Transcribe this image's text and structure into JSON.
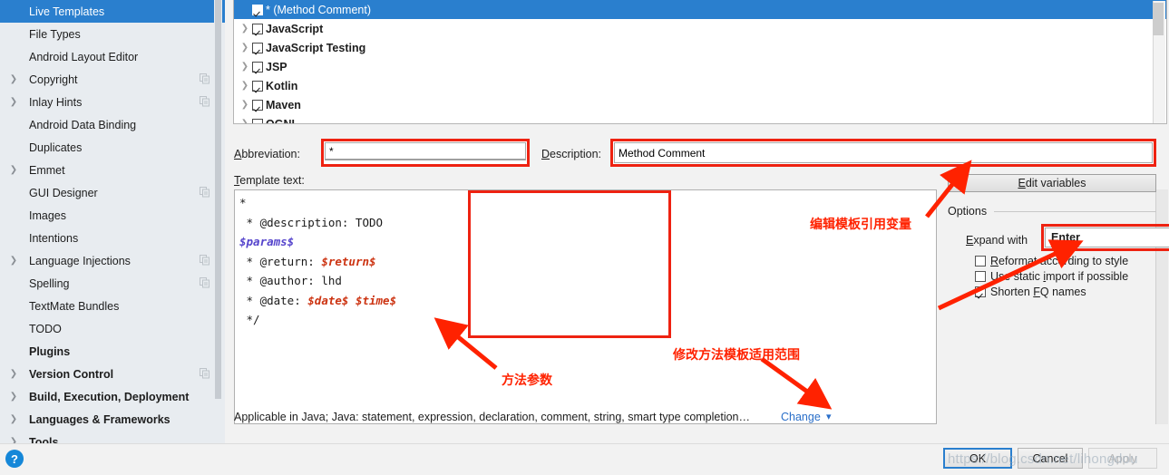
{
  "sidebar": {
    "items": [
      {
        "label": "Live Templates",
        "selected": true,
        "expandable": false,
        "bold": false,
        "copy": false
      },
      {
        "label": "File Types",
        "selected": false,
        "expandable": false,
        "bold": false,
        "copy": false
      },
      {
        "label": "Android Layout Editor",
        "selected": false,
        "expandable": false,
        "bold": false,
        "copy": false
      },
      {
        "label": "Copyright",
        "selected": false,
        "expandable": true,
        "bold": false,
        "copy": true
      },
      {
        "label": "Inlay Hints",
        "selected": false,
        "expandable": true,
        "bold": false,
        "copy": true
      },
      {
        "label": "Android Data Binding",
        "selected": false,
        "expandable": false,
        "bold": false,
        "copy": false
      },
      {
        "label": "Duplicates",
        "selected": false,
        "expandable": false,
        "bold": false,
        "copy": false
      },
      {
        "label": "Emmet",
        "selected": false,
        "expandable": true,
        "bold": false,
        "copy": false
      },
      {
        "label": "GUI Designer",
        "selected": false,
        "expandable": false,
        "bold": false,
        "copy": true
      },
      {
        "label": "Images",
        "selected": false,
        "expandable": false,
        "bold": false,
        "copy": false
      },
      {
        "label": "Intentions",
        "selected": false,
        "expandable": false,
        "bold": false,
        "copy": false
      },
      {
        "label": "Language Injections",
        "selected": false,
        "expandable": true,
        "bold": false,
        "copy": true
      },
      {
        "label": "Spelling",
        "selected": false,
        "expandable": false,
        "bold": false,
        "copy": true
      },
      {
        "label": "TextMate Bundles",
        "selected": false,
        "expandable": false,
        "bold": false,
        "copy": false
      },
      {
        "label": "TODO",
        "selected": false,
        "expandable": false,
        "bold": false,
        "copy": false
      },
      {
        "label": "Plugins",
        "selected": false,
        "expandable": false,
        "bold": true,
        "copy": false
      },
      {
        "label": "Version Control",
        "selected": false,
        "expandable": true,
        "bold": true,
        "copy": true
      },
      {
        "label": "Build, Execution, Deployment",
        "selected": false,
        "expandable": true,
        "bold": true,
        "copy": false
      },
      {
        "label": "Languages & Frameworks",
        "selected": false,
        "expandable": true,
        "bold": true,
        "copy": false
      },
      {
        "label": "Tools",
        "selected": false,
        "expandable": true,
        "bold": true,
        "copy": false
      }
    ]
  },
  "tree": {
    "rows": [
      {
        "label": "* (Method Comment)",
        "checked": true,
        "selected": true,
        "expandable": false
      },
      {
        "label": "JavaScript",
        "checked": true,
        "selected": false,
        "expandable": true
      },
      {
        "label": "JavaScript Testing",
        "checked": true,
        "selected": false,
        "expandable": true
      },
      {
        "label": "JSP",
        "checked": true,
        "selected": false,
        "expandable": true
      },
      {
        "label": "Kotlin",
        "checked": true,
        "selected": false,
        "expandable": true
      },
      {
        "label": "Maven",
        "checked": true,
        "selected": false,
        "expandable": true
      },
      {
        "label": "OGNL",
        "checked": true,
        "selected": false,
        "expandable": true
      }
    ]
  },
  "fields": {
    "abbreviation_label": "Abbreviation:",
    "abbreviation_value": "*",
    "description_label": "Description:",
    "description_value": "Method Comment",
    "template_text_label": "Template text:",
    "template_text_value": "*\n * @description: TODO\n$params$\n * @return: $return$\n * @author: lhd\n * @date: $date$ $time$\n */"
  },
  "options": {
    "edit_variables_label": "Edit variables",
    "title": "Options",
    "expand_with_label": "Expand with",
    "expand_with_value": "Enter",
    "checkboxes": [
      {
        "label": "Reformat according to style",
        "checked": false
      },
      {
        "label": "Use static import if possible",
        "checked": false
      },
      {
        "label": "Shorten FQ names",
        "checked": true
      }
    ]
  },
  "footer": {
    "applicable_text": "Applicable in Java; Java: statement, expression, declaration, comment, string, smart type completion…",
    "change_label": "Change"
  },
  "dialog": {
    "help_icon": "question-mark",
    "ok_label": "OK",
    "cancel_label": "Cancel",
    "apply_label": "Apply"
  },
  "annotations": {
    "edit_variables": "编辑模板引用变量",
    "scope": "修改方法模板适用范围",
    "params": "方法参数"
  },
  "watermark": "https://blog.csdn.net/lihongdou",
  "colors": {
    "accent_blue": "#2a7fce",
    "annotation_red": "#ff2200",
    "highlight_red": "#ee2211",
    "sidebar_bg": "#e8ecf0",
    "panel_bg": "#f2f2f2",
    "link_blue": "#2a6fc9"
  }
}
